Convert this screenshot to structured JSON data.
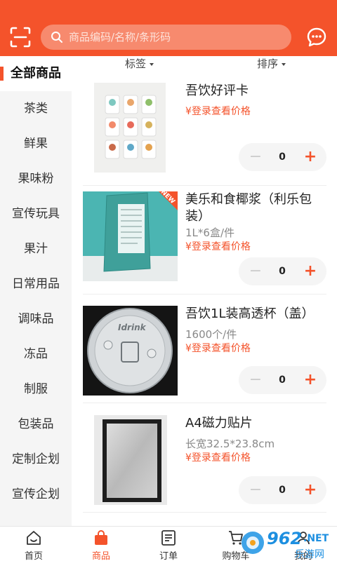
{
  "search": {
    "placeholder": "商品编码/名称/条形码"
  },
  "icons": {
    "scan": "scan-icon",
    "search": "search-icon",
    "message": "message-icon"
  },
  "colors": {
    "accent": "#f4532b",
    "header_bg": "#f4532b",
    "sidebar_bg": "#f5f5f5",
    "price": "#f4532b"
  },
  "filters": {
    "tag_label": "标签",
    "sort_label": "排序"
  },
  "sidebar": {
    "items": [
      {
        "label": "全部商品",
        "active": true
      },
      {
        "label": "茶类"
      },
      {
        "label": "鲜果"
      },
      {
        "label": "果味粉"
      },
      {
        "label": "宣传玩具"
      },
      {
        "label": "果汁"
      },
      {
        "label": "日常用品"
      },
      {
        "label": "调味品"
      },
      {
        "label": "冻品"
      },
      {
        "label": "制服"
      },
      {
        "label": "包装品"
      },
      {
        "label": "定制企划"
      },
      {
        "label": "宣传企划"
      }
    ]
  },
  "products": [
    {
      "title": "吾饮好评卡",
      "spec": "",
      "price": "¥登录查看价格",
      "quantity": "0",
      "minus": "−",
      "plus": "+"
    },
    {
      "title": "美乐和食椰浆（利乐包装）",
      "spec": "1L*6盒/件",
      "price": "¥登录查看价格",
      "quantity": "0",
      "minus": "−",
      "plus": "+",
      "badge": "NEW"
    },
    {
      "title": "吾饮1L装高透杯（盖）",
      "spec": "1600个/件",
      "price": "¥登录查看价格",
      "quantity": "0",
      "minus": "−",
      "plus": "+",
      "lid_text": "Idrink"
    },
    {
      "title": "A4磁力贴片",
      "spec": "长宽32.5*23.8cm",
      "price": "¥登录查看价格",
      "quantity": "0",
      "minus": "−",
      "plus": "+"
    }
  ],
  "tabbar": {
    "items": [
      {
        "label": "首页",
        "icon": "home-icon"
      },
      {
        "label": "商品",
        "icon": "shopping-bag-icon",
        "active": true
      },
      {
        "label": "订单",
        "icon": "order-list-icon"
      },
      {
        "label": "购物车",
        "icon": "cart-icon"
      },
      {
        "label": "我的",
        "icon": "user-icon"
      }
    ]
  },
  "watermark": {
    "brand": "962",
    "suffix": ".NET",
    "subtitle": "乐游网"
  }
}
